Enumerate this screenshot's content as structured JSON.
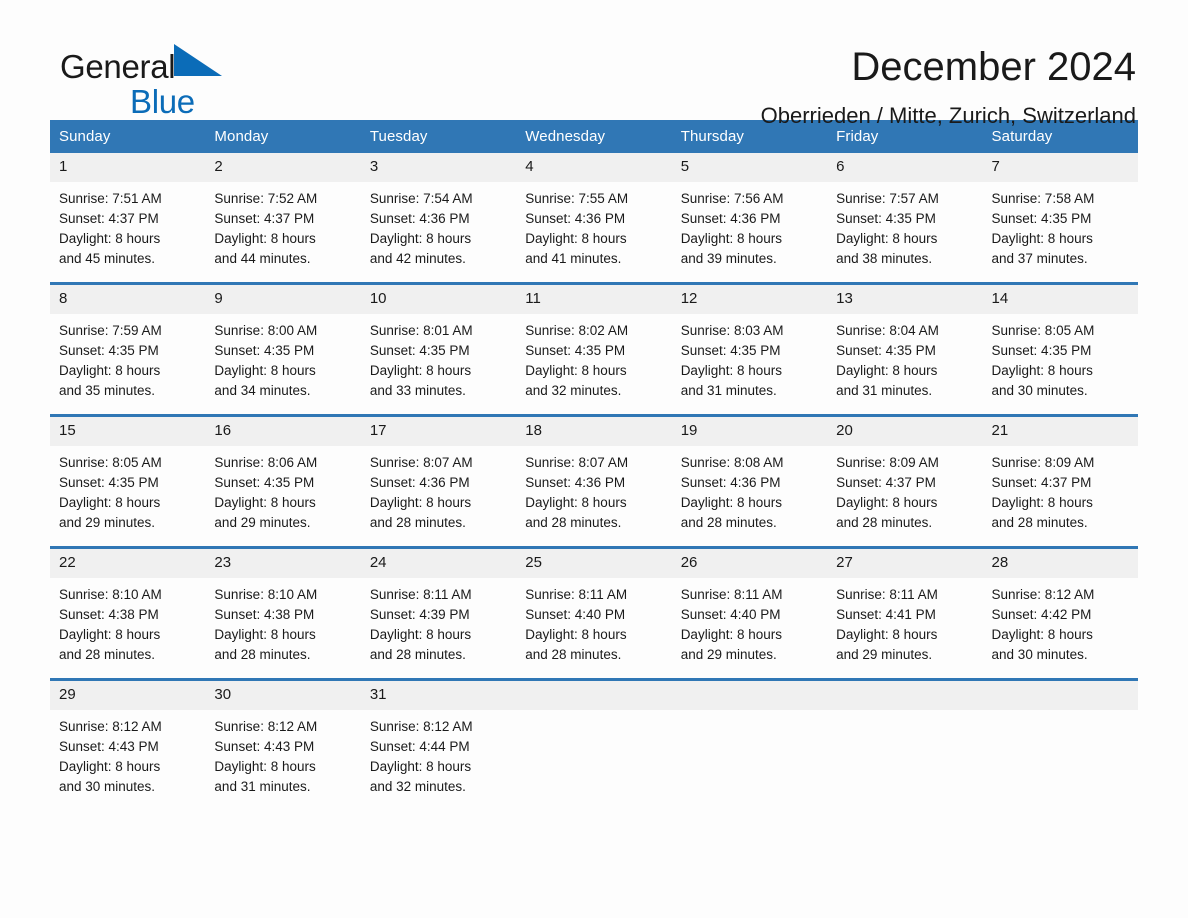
{
  "brand": {
    "name_part1": "General",
    "name_part2": "Blue",
    "accent_color": "#0b6cb8"
  },
  "header": {
    "title": "December 2024",
    "subtitle": "Oberrieden / Mitte, Zurich, Switzerland"
  },
  "theme": {
    "header_blue": "#3077b5",
    "daynum_band": "#f0f0f0",
    "page_background": "#fdfdfd"
  },
  "weekday_headers": [
    "Sunday",
    "Monday",
    "Tuesday",
    "Wednesday",
    "Thursday",
    "Friday",
    "Saturday"
  ],
  "weeks": [
    [
      {
        "day": "1",
        "sunrise": "Sunrise: 7:51 AM",
        "sunset": "Sunset: 4:37 PM",
        "daylight1": "Daylight: 8 hours",
        "daylight2": "and 45 minutes."
      },
      {
        "day": "2",
        "sunrise": "Sunrise: 7:52 AM",
        "sunset": "Sunset: 4:37 PM",
        "daylight1": "Daylight: 8 hours",
        "daylight2": "and 44 minutes."
      },
      {
        "day": "3",
        "sunrise": "Sunrise: 7:54 AM",
        "sunset": "Sunset: 4:36 PM",
        "daylight1": "Daylight: 8 hours",
        "daylight2": "and 42 minutes."
      },
      {
        "day": "4",
        "sunrise": "Sunrise: 7:55 AM",
        "sunset": "Sunset: 4:36 PM",
        "daylight1": "Daylight: 8 hours",
        "daylight2": "and 41 minutes."
      },
      {
        "day": "5",
        "sunrise": "Sunrise: 7:56 AM",
        "sunset": "Sunset: 4:36 PM",
        "daylight1": "Daylight: 8 hours",
        "daylight2": "and 39 minutes."
      },
      {
        "day": "6",
        "sunrise": "Sunrise: 7:57 AM",
        "sunset": "Sunset: 4:35 PM",
        "daylight1": "Daylight: 8 hours",
        "daylight2": "and 38 minutes."
      },
      {
        "day": "7",
        "sunrise": "Sunrise: 7:58 AM",
        "sunset": "Sunset: 4:35 PM",
        "daylight1": "Daylight: 8 hours",
        "daylight2": "and 37 minutes."
      }
    ],
    [
      {
        "day": "8",
        "sunrise": "Sunrise: 7:59 AM",
        "sunset": "Sunset: 4:35 PM",
        "daylight1": "Daylight: 8 hours",
        "daylight2": "and 35 minutes."
      },
      {
        "day": "9",
        "sunrise": "Sunrise: 8:00 AM",
        "sunset": "Sunset: 4:35 PM",
        "daylight1": "Daylight: 8 hours",
        "daylight2": "and 34 minutes."
      },
      {
        "day": "10",
        "sunrise": "Sunrise: 8:01 AM",
        "sunset": "Sunset: 4:35 PM",
        "daylight1": "Daylight: 8 hours",
        "daylight2": "and 33 minutes."
      },
      {
        "day": "11",
        "sunrise": "Sunrise: 8:02 AM",
        "sunset": "Sunset: 4:35 PM",
        "daylight1": "Daylight: 8 hours",
        "daylight2": "and 32 minutes."
      },
      {
        "day": "12",
        "sunrise": "Sunrise: 8:03 AM",
        "sunset": "Sunset: 4:35 PM",
        "daylight1": "Daylight: 8 hours",
        "daylight2": "and 31 minutes."
      },
      {
        "day": "13",
        "sunrise": "Sunrise: 8:04 AM",
        "sunset": "Sunset: 4:35 PM",
        "daylight1": "Daylight: 8 hours",
        "daylight2": "and 31 minutes."
      },
      {
        "day": "14",
        "sunrise": "Sunrise: 8:05 AM",
        "sunset": "Sunset: 4:35 PM",
        "daylight1": "Daylight: 8 hours",
        "daylight2": "and 30 minutes."
      }
    ],
    [
      {
        "day": "15",
        "sunrise": "Sunrise: 8:05 AM",
        "sunset": "Sunset: 4:35 PM",
        "daylight1": "Daylight: 8 hours",
        "daylight2": "and 29 minutes."
      },
      {
        "day": "16",
        "sunrise": "Sunrise: 8:06 AM",
        "sunset": "Sunset: 4:35 PM",
        "daylight1": "Daylight: 8 hours",
        "daylight2": "and 29 minutes."
      },
      {
        "day": "17",
        "sunrise": "Sunrise: 8:07 AM",
        "sunset": "Sunset: 4:36 PM",
        "daylight1": "Daylight: 8 hours",
        "daylight2": "and 28 minutes."
      },
      {
        "day": "18",
        "sunrise": "Sunrise: 8:07 AM",
        "sunset": "Sunset: 4:36 PM",
        "daylight1": "Daylight: 8 hours",
        "daylight2": "and 28 minutes."
      },
      {
        "day": "19",
        "sunrise": "Sunrise: 8:08 AM",
        "sunset": "Sunset: 4:36 PM",
        "daylight1": "Daylight: 8 hours",
        "daylight2": "and 28 minutes."
      },
      {
        "day": "20",
        "sunrise": "Sunrise: 8:09 AM",
        "sunset": "Sunset: 4:37 PM",
        "daylight1": "Daylight: 8 hours",
        "daylight2": "and 28 minutes."
      },
      {
        "day": "21",
        "sunrise": "Sunrise: 8:09 AM",
        "sunset": "Sunset: 4:37 PM",
        "daylight1": "Daylight: 8 hours",
        "daylight2": "and 28 minutes."
      }
    ],
    [
      {
        "day": "22",
        "sunrise": "Sunrise: 8:10 AM",
        "sunset": "Sunset: 4:38 PM",
        "daylight1": "Daylight: 8 hours",
        "daylight2": "and 28 minutes."
      },
      {
        "day": "23",
        "sunrise": "Sunrise: 8:10 AM",
        "sunset": "Sunset: 4:38 PM",
        "daylight1": "Daylight: 8 hours",
        "daylight2": "and 28 minutes."
      },
      {
        "day": "24",
        "sunrise": "Sunrise: 8:11 AM",
        "sunset": "Sunset: 4:39 PM",
        "daylight1": "Daylight: 8 hours",
        "daylight2": "and 28 minutes."
      },
      {
        "day": "25",
        "sunrise": "Sunrise: 8:11 AM",
        "sunset": "Sunset: 4:40 PM",
        "daylight1": "Daylight: 8 hours",
        "daylight2": "and 28 minutes."
      },
      {
        "day": "26",
        "sunrise": "Sunrise: 8:11 AM",
        "sunset": "Sunset: 4:40 PM",
        "daylight1": "Daylight: 8 hours",
        "daylight2": "and 29 minutes."
      },
      {
        "day": "27",
        "sunrise": "Sunrise: 8:11 AM",
        "sunset": "Sunset: 4:41 PM",
        "daylight1": "Daylight: 8 hours",
        "daylight2": "and 29 minutes."
      },
      {
        "day": "28",
        "sunrise": "Sunrise: 8:12 AM",
        "sunset": "Sunset: 4:42 PM",
        "daylight1": "Daylight: 8 hours",
        "daylight2": "and 30 minutes."
      }
    ],
    [
      {
        "day": "29",
        "sunrise": "Sunrise: 8:12 AM",
        "sunset": "Sunset: 4:43 PM",
        "daylight1": "Daylight: 8 hours",
        "daylight2": "and 30 minutes."
      },
      {
        "day": "30",
        "sunrise": "Sunrise: 8:12 AM",
        "sunset": "Sunset: 4:43 PM",
        "daylight1": "Daylight: 8 hours",
        "daylight2": "and 31 minutes."
      },
      {
        "day": "31",
        "sunrise": "Sunrise: 8:12 AM",
        "sunset": "Sunset: 4:44 PM",
        "daylight1": "Daylight: 8 hours",
        "daylight2": "and 32 minutes."
      },
      {
        "day": "",
        "sunrise": "",
        "sunset": "",
        "daylight1": "",
        "daylight2": ""
      },
      {
        "day": "",
        "sunrise": "",
        "sunset": "",
        "daylight1": "",
        "daylight2": ""
      },
      {
        "day": "",
        "sunrise": "",
        "sunset": "",
        "daylight1": "",
        "daylight2": ""
      },
      {
        "day": "",
        "sunrise": "",
        "sunset": "",
        "daylight1": "",
        "daylight2": ""
      }
    ]
  ]
}
